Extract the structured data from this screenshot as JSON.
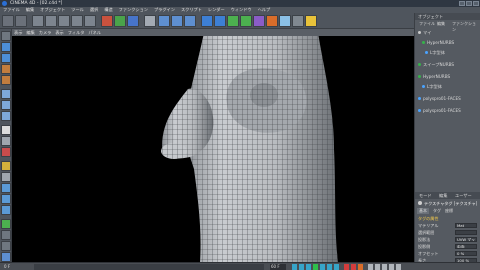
{
  "window": {
    "title": "CINEMA 4D - [02.c4d *]",
    "buttons": [
      "minimize",
      "maximize",
      "close"
    ]
  },
  "menubar": {
    "items": [
      "ファイル",
      "編集",
      "オブジェクト",
      "ツール",
      "選択",
      "構造",
      "ファンクション",
      "プラグイン",
      "スクリプト",
      "レンダー",
      "ウィンドウ",
      "ヘルプ"
    ]
  },
  "toolbar": {
    "icons": [
      "undo-icon",
      "redo-icon",
      "live-selection-icon",
      "move-icon",
      "scale-icon",
      "rotate-icon",
      "recent-tools-icon",
      "x-axis-icon",
      "y-axis-icon",
      "z-axis-icon",
      "world-coordinates-icon",
      "render-view-icon",
      "render-picture-viewer-icon",
      "render-settings-icon",
      "cube-icon",
      "pen-icon",
      "subdivision-icon",
      "array-icon",
      "boole-icon",
      "deformer-icon",
      "environment-icon",
      "camera-icon",
      "light-icon"
    ]
  },
  "left_tools": {
    "icons": [
      "make-editable-icon",
      "model-mode-icon",
      "object-mode-icon",
      "texture-mode-icon",
      "texture-axis-icon",
      "points-mode-icon",
      "edges-mode-icon",
      "polygons-mode-icon",
      "checker-icon",
      "workplane-icon",
      "snap-icon",
      "magnet-icon",
      "knife-icon",
      "extrude-icon",
      "bridge-icon",
      "weld-icon",
      "hypernurbs-weight-icon",
      "sculpt-icon",
      "tweak-icon",
      "render-region-icon",
      "layers-icon"
    ]
  },
  "viewport": {
    "menu": [
      "表示",
      "編集",
      "カメラ",
      "表示",
      "フィルタ",
      "パネル"
    ]
  },
  "object_manager": {
    "header": "オブジェクト",
    "tabs": [
      "ファイル",
      "編集",
      "ファンクション"
    ],
    "rows": [
      {
        "label": "マイ",
        "color": "#c8c8c8"
      },
      {
        "label": "HyperNURBS",
        "color": "#36b24a"
      },
      {
        "label": "L字型体",
        "color": "#4aa3ff"
      },
      {
        "label": "スイープNURBS",
        "color": "#36b24a"
      },
      {
        "label": "HyperNURBS",
        "color": "#36b24a"
      },
      {
        "label": "L字型体",
        "color": "#4aa3ff"
      },
      {
        "label": "polyspro01-FACES",
        "color": "#4aa3ff"
      },
      {
        "label": "polyspro01-FACES",
        "color": "#4aa3ff"
      }
    ]
  },
  "attribute_manager": {
    "header_tabs": [
      "モード",
      "編集",
      "ユーザー"
    ],
    "object_label": "テクスチャタグ [テクスチャ]",
    "tabs": [
      "基本",
      "タグ",
      "座標"
    ],
    "section": "タグの属性",
    "properties": [
      {
        "label": "マテリアル",
        "value": "Mat"
      },
      {
        "label": "選択範囲",
        "value": ""
      },
      {
        "label": "投影法",
        "value": "UVW マッピング"
      },
      {
        "label": "投影側",
        "value": "両面"
      },
      {
        "label": "オフセット",
        "value": "0 %"
      },
      {
        "label": "長さ",
        "value": "100 %"
      }
    ]
  },
  "timeline": {
    "left_label": "0 F",
    "frame_field": "60 F",
    "playback_icons": [
      "goto-start-icon",
      "prev-key-icon",
      "prev-frame-icon",
      "play-icon",
      "next-frame-icon",
      "next-key-icon",
      "goto-end-icon",
      "record-icon",
      "auto-key-icon",
      "keyframe-selection-icon",
      "position-key-icon",
      "rotation-key-icon",
      "scale-key-icon",
      "param-key-icon",
      "pla-key-icon"
    ]
  }
}
